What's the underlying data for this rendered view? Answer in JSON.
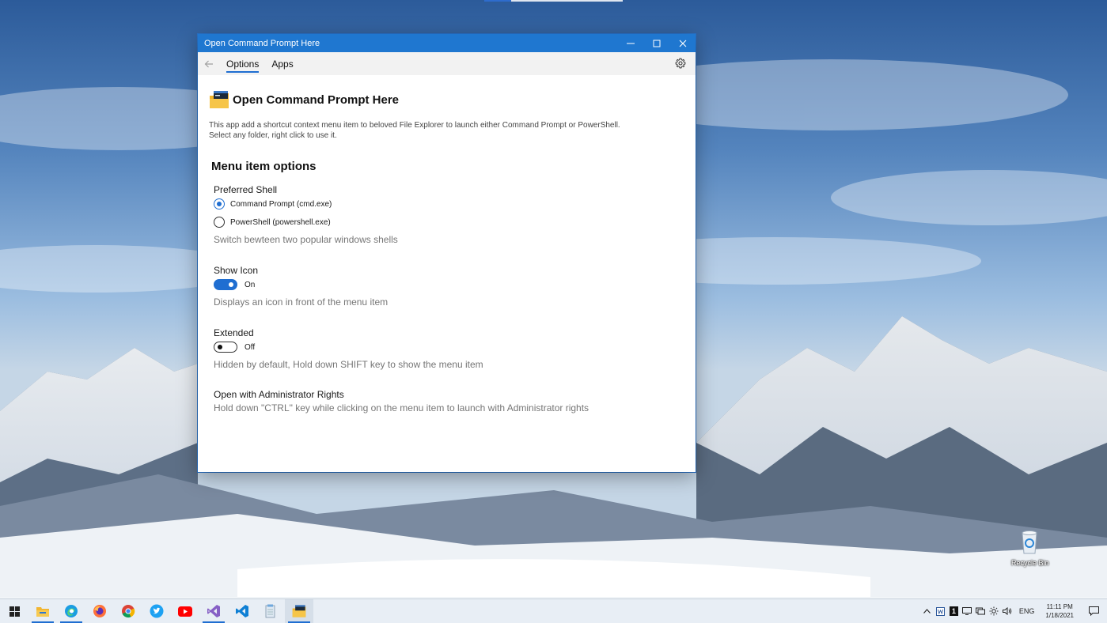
{
  "window": {
    "title": "Open Command Prompt Here",
    "titlebar_color": "#1f77d0"
  },
  "nav": {
    "tabs": [
      {
        "label": "Options",
        "active": true
      },
      {
        "label": "Apps",
        "active": false
      }
    ]
  },
  "app": {
    "title": "Open Command Prompt Here",
    "description_line1": "This app add a shortcut context menu item to beloved File Explorer to launch either Command Prompt or PowerShell.",
    "description_line2": "Select any folder, right click to use it."
  },
  "options": {
    "section_title": "Menu item options",
    "preferred_shell": {
      "label": "Preferred Shell",
      "choices": [
        {
          "label": "Command Prompt (cmd.exe)",
          "checked": true
        },
        {
          "label": "PowerShell (powershell.exe)",
          "checked": false
        }
      ],
      "hint": "Switch bewteen two popular windows shells"
    },
    "show_icon": {
      "label": "Show Icon",
      "state": "On",
      "hint": "Displays an icon in front of the menu item"
    },
    "extended": {
      "label": "Extended",
      "state": "Off",
      "hint": "Hidden by default, Hold down SHIFT key to show the menu item"
    },
    "admin": {
      "label": "Open with Administrator Rights",
      "hint": "Hold down \"CTRL\" key while clicking on the menu item to launch with Administrator rights"
    }
  },
  "desktop": {
    "recycle_bin_label": "Recycle Bin"
  },
  "taskbar": {
    "apps": [
      "start-icon",
      "file-explorer-icon",
      "edge-icon",
      "firefox-icon",
      "chrome-icon",
      "twitter-icon",
      "youtube-icon",
      "visual-studio-icon",
      "vscode-icon",
      "notepad-icon",
      "cmd-here-icon"
    ],
    "tray": {
      "language": "ENG",
      "time": "11:11 PM",
      "date": "1/18/2021",
      "badge_number": "1"
    }
  },
  "colors": {
    "accent": "#1f6ed1"
  }
}
